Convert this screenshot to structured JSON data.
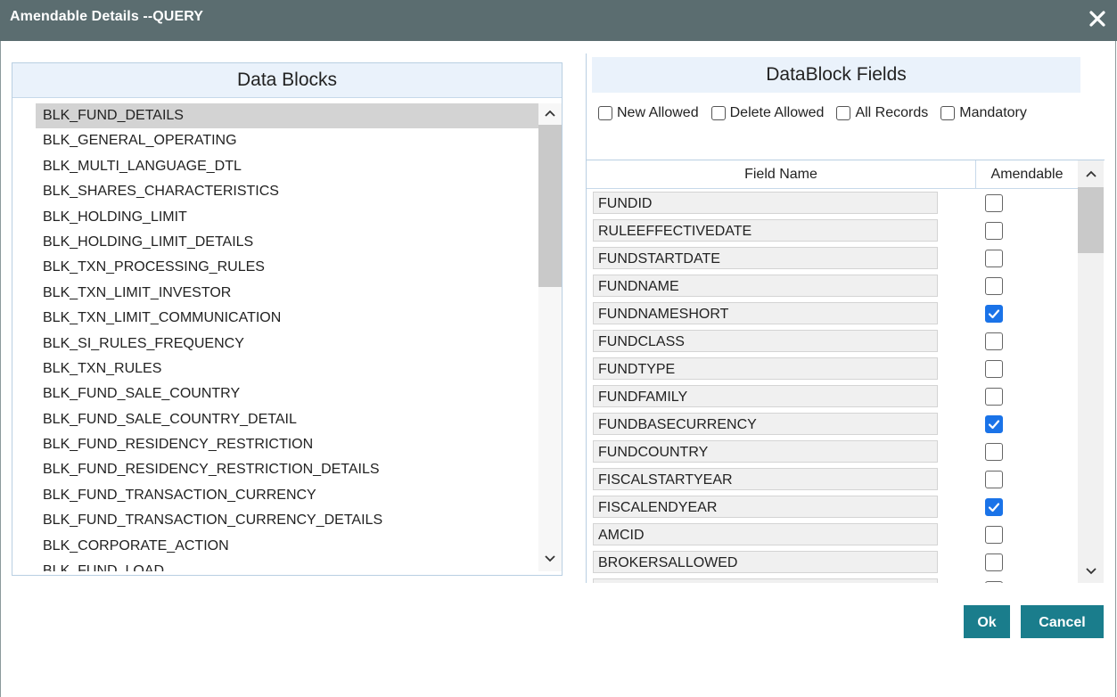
{
  "window": {
    "title": "Amendable Details --QUERY"
  },
  "data_blocks": {
    "header": "Data Blocks",
    "selected_index": 0,
    "items": [
      "BLK_FUND_DETAILS",
      "BLK_GENERAL_OPERATING",
      "BLK_MULTI_LANGUAGE_DTL",
      "BLK_SHARES_CHARACTERISTICS",
      "BLK_HOLDING_LIMIT",
      "BLK_HOLDING_LIMIT_DETAILS",
      "BLK_TXN_PROCESSING_RULES",
      "BLK_TXN_LIMIT_INVESTOR",
      "BLK_TXN_LIMIT_COMMUNICATION",
      "BLK_SI_RULES_FREQUENCY",
      "BLK_TXN_RULES",
      "BLK_FUND_SALE_COUNTRY",
      "BLK_FUND_SALE_COUNTRY_DETAIL",
      "BLK_FUND_RESIDENCY_RESTRICTION",
      "BLK_FUND_RESIDENCY_RESTRICTION_DETAILS",
      "BLK_FUND_TRANSACTION_CURRENCY",
      "BLK_FUND_TRANSACTION_CURRENCY_DETAILS",
      "BLK_CORPORATE_ACTION",
      "BLK_FUND_LOAD"
    ]
  },
  "datablock_fields": {
    "header": "DataBlock Fields",
    "options": [
      {
        "label": "New Allowed",
        "checked": false
      },
      {
        "label": "Delete Allowed",
        "checked": false
      },
      {
        "label": "All Records",
        "checked": false
      },
      {
        "label": "Mandatory",
        "checked": false
      }
    ],
    "columns": {
      "field_name": "Field Name",
      "amendable": "Amendable"
    },
    "rows": [
      {
        "field": "FUNDID",
        "amendable": false
      },
      {
        "field": "RULEEFFECTIVEDATE",
        "amendable": false
      },
      {
        "field": "FUNDSTARTDATE",
        "amendable": false
      },
      {
        "field": "FUNDNAME",
        "amendable": false
      },
      {
        "field": "FUNDNAMESHORT",
        "amendable": true
      },
      {
        "field": "FUNDCLASS",
        "amendable": false
      },
      {
        "field": "FUNDTYPE",
        "amendable": false
      },
      {
        "field": "FUNDFAMILY",
        "amendable": false
      },
      {
        "field": "FUNDBASECURRENCY",
        "amendable": true
      },
      {
        "field": "FUNDCOUNTRY",
        "amendable": false
      },
      {
        "field": "FISCALSTARTYEAR",
        "amendable": false
      },
      {
        "field": "FISCALENDYEAR",
        "amendable": true
      },
      {
        "field": "AMCID",
        "amendable": false
      },
      {
        "field": "BROKERSALLOWED",
        "amendable": false
      },
      {
        "field": "",
        "amendable": false
      }
    ]
  },
  "buttons": {
    "ok": "Ok",
    "cancel": "Cancel"
  },
  "colors": {
    "titlebar": "#5b6d70",
    "panel_header": "#eaf2fb",
    "button": "#1a7d8c",
    "checkbox_checked": "#1a73e8"
  },
  "icons": {
    "close": "close-icon",
    "scroll_up": "chevron-up-icon",
    "scroll_down": "chevron-down-icon",
    "check": "checkmark-icon"
  }
}
